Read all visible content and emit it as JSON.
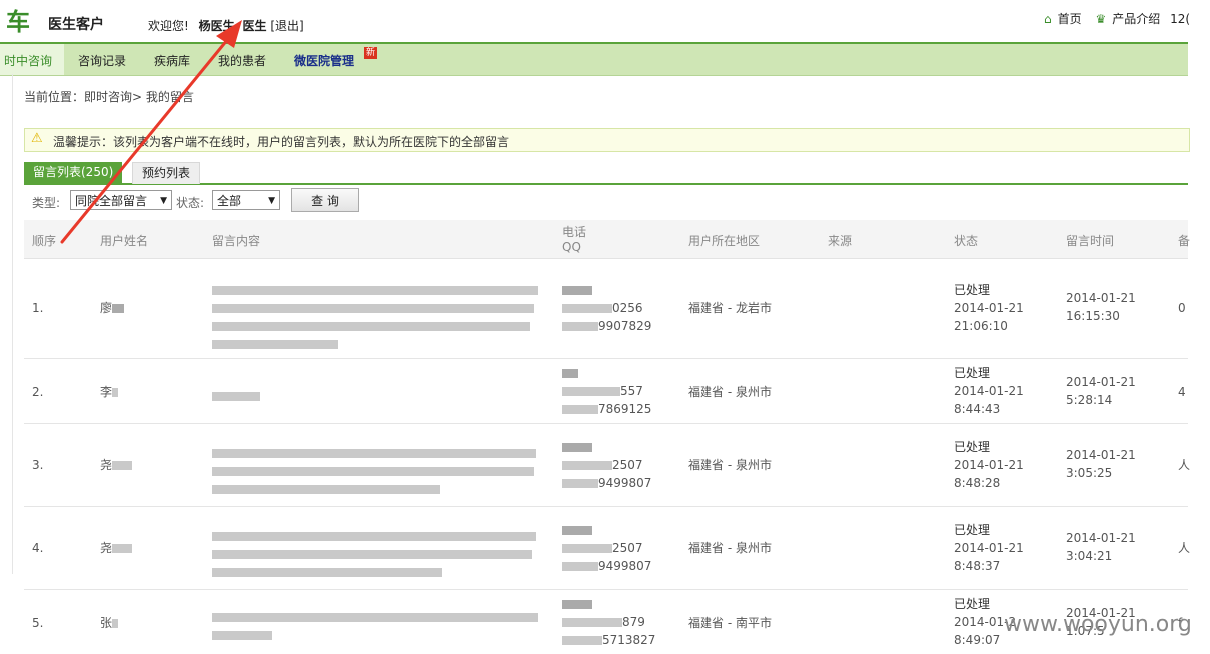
{
  "header": {
    "logo_fragment": "车",
    "brand": "医生客户",
    "welcome_prefix": "欢迎您!",
    "user_name": "杨医生",
    "user_role": "医生",
    "logout": "[退出]",
    "home": "首页",
    "product": "产品介绍",
    "phone_fragment": "12("
  },
  "nav": {
    "items": [
      "即时咨询",
      "咨询记录",
      "疾病库",
      "我的患者",
      "微医院管理"
    ],
    "active_fragment": "时中咨询",
    "new_badge": "新"
  },
  "breadcrumb": "当前位置：即时咨询> 我的留言",
  "notice": "温馨提示：该列表为客户端不在线时，用户的留言列表，默认为所在医院下的全部留言",
  "tabs": {
    "messages": "留言列表(250)",
    "appointments": "预约列表"
  },
  "filter": {
    "type_label": "类型:",
    "type_value": "同院全部留言",
    "status_label": "状态:",
    "status_value": "全部",
    "query": "查 询"
  },
  "columns": {
    "index": "顺序",
    "name": "用户姓名",
    "content": "留言内容",
    "phone": "电话",
    "qq": "QQ",
    "region": "用户所在地区",
    "source": "来源",
    "status": "状态",
    "time": "留言时间",
    "remark_fragment": "备"
  },
  "rows": [
    {
      "index": "1.",
      "name": "廖",
      "phone_tail": "0256",
      "qq_tail": "9907829",
      "region": "福建省 - 龙岩市",
      "status": "已处理",
      "status_date": "2014-01-21",
      "status_time": "21:06:10",
      "msg_date": "2014-01-21",
      "msg_time": "16:15:30",
      "extra": "0"
    },
    {
      "index": "2.",
      "name": "李",
      "phone_tail": "557",
      "qq_tail": "7869125",
      "region": "福建省 - 泉州市",
      "status": "已处理",
      "status_date": "2014-01-21",
      "status_time": "8:44:43",
      "msg_date": "2014-01-21",
      "msg_time": "5:28:14",
      "extra": "4"
    },
    {
      "index": "3.",
      "name": "尧",
      "phone_tail": "2507",
      "qq_tail": "9499807",
      "region": "福建省 - 泉州市",
      "status": "已处理",
      "status_date": "2014-01-21",
      "status_time": "8:48:28",
      "msg_date": "2014-01-21",
      "msg_time": "3:05:25",
      "extra": "人"
    },
    {
      "index": "4.",
      "name": "尧",
      "phone_tail": "2507",
      "qq_tail": "9499807",
      "region": "福建省 - 泉州市",
      "status": "已处理",
      "status_date": "2014-01-21",
      "status_time": "8:48:37",
      "msg_date": "2014-01-21",
      "msg_time": "3:04:21",
      "extra": "人"
    },
    {
      "index": "5.",
      "name": "张",
      "phone_tail": "879",
      "qq_tail": "5713827",
      "region": "福建省 - 南平市",
      "status": "已处理",
      "status_date": "2014-01-2",
      "status_time": "8:49:07",
      "msg_date": "2014-01-21",
      "msg_time": "1:07:5",
      "extra": "f"
    }
  ],
  "watermark": "www.wooyun.org",
  "colors": {
    "accent": "#5aa33a",
    "nav_bg": "#cfe6b5",
    "annotation": "#e8392a"
  }
}
